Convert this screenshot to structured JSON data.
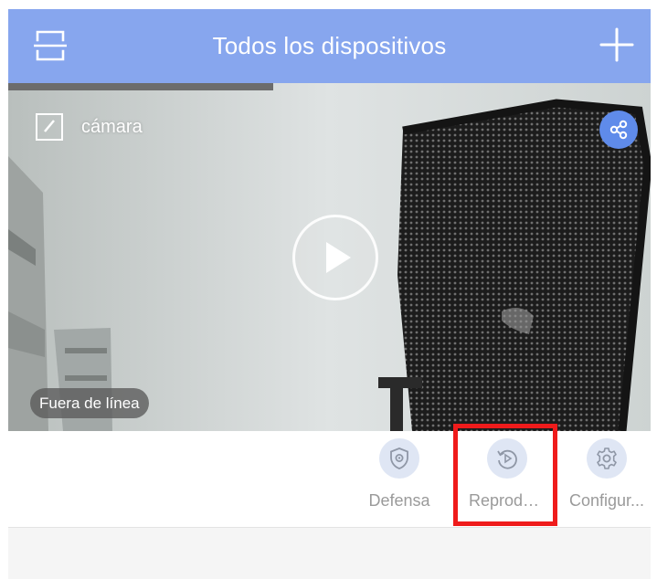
{
  "header": {
    "title": "Todos los dispositivos",
    "background": "#87a6ee",
    "left_icon": "scan-icon",
    "right_icon": "plus-icon"
  },
  "device": {
    "name": "cámara",
    "status": "Fuera de línea",
    "edit_icon": "edit-icon",
    "share_icon": "share-icon",
    "play_icon": "play-icon"
  },
  "actions": [
    {
      "label": "Defensa",
      "icon": "shield-icon"
    },
    {
      "label": "Reprodu...",
      "icon": "playback-icon",
      "highlighted": true
    },
    {
      "label": "Configur...",
      "icon": "gear-icon"
    }
  ],
  "colors": {
    "accent": "#5f8bea",
    "highlight": "#ef1b1b",
    "icon_bg": "#dfe6f4",
    "label": "#9a9a9a"
  }
}
